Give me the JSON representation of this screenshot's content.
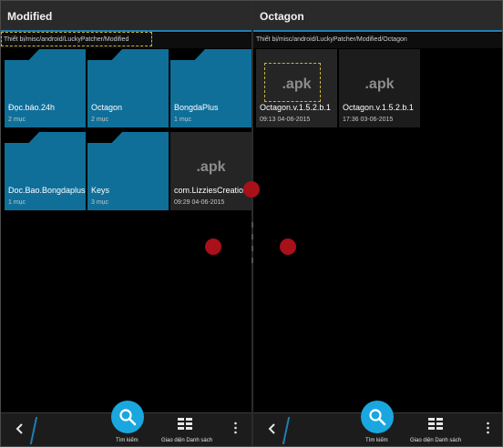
{
  "left_pane": {
    "title": "Modified",
    "path": "Thiết bị/misc/android/LuckyPatcher/Modified",
    "items": [
      {
        "type": "folder",
        "name": "Đọc.báo.24h",
        "meta": "2 mục"
      },
      {
        "type": "folder",
        "name": "Octagon",
        "meta": "2 mục"
      },
      {
        "type": "folder",
        "name": "BongdaPlus",
        "meta": "1 mục"
      },
      {
        "type": "folder",
        "name": "Doc.Bao.Bongdaplus",
        "meta": "1 mục"
      },
      {
        "type": "folder",
        "name": "Keys",
        "meta": "3 mục"
      },
      {
        "type": "file",
        "name": "com.LizziesCreation",
        "meta": "09:29 04-06-2015",
        "thumb": ".apk"
      }
    ],
    "bottom": {
      "search_label": "Tìm kiếm",
      "view_label": "Giao diện Danh sách"
    }
  },
  "right_pane": {
    "title": "Octagon",
    "path": "Thiết bị/misc/android/LuckyPatcher/Modified/Octagon",
    "items": [
      {
        "type": "file",
        "name": "Octagon.v.1.5.2.b.1",
        "meta": "09:13 04-06-2015",
        "thumb": ".apk"
      },
      {
        "type": "file",
        "name": "Octagon.v.1.5.2.b.1",
        "meta": "17:36 03-06-2015",
        "thumb": ".apk"
      }
    ],
    "bottom": {
      "search_label": "Tìm kiếm",
      "view_label": "Giao diện Danh sách"
    }
  },
  "icons": {
    "back": "back-arrow-icon",
    "search": "search-icon",
    "list_view": "grid-view-icon",
    "more": "more-vertical-icon"
  },
  "colors": {
    "accent": "#1f7fb6",
    "folder": "#0f6f99",
    "search_button": "#1aa7e0",
    "touch_marker": "#a8101a",
    "selection_outline": "#c9b43c"
  }
}
